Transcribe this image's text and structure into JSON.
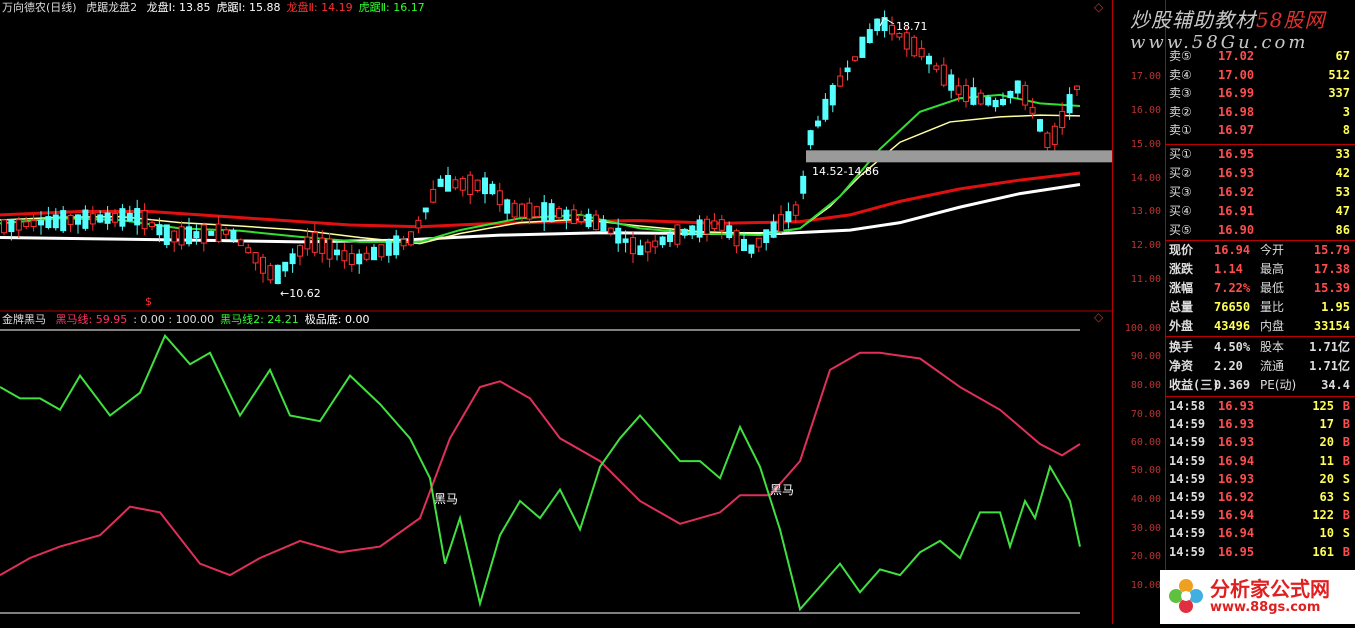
{
  "header_main": {
    "title": "万向德农(日线)",
    "indicator": "虎踞龙盘2",
    "items": [
      {
        "label": "龙盘Ⅰ: 13.85",
        "color": "#ffffff"
      },
      {
        "label": "虎踞Ⅰ: 15.88",
        "color": "#ffffff"
      },
      {
        "label": "龙盘Ⅱ: 14.19",
        "color": "#ff3030"
      },
      {
        "label": "虎踞Ⅱ: 16.17",
        "color": "#30ff30"
      }
    ]
  },
  "header_sub": {
    "title": "金牌黑马",
    "items": [
      {
        "label": "黑马线: 59.95",
        "color": "#ff3366"
      },
      {
        "label": ": 0.00 : 100.00",
        "color": "#dddddd"
      },
      {
        "label": "黑马线2: 24.21",
        "color": "#30ff30"
      },
      {
        "label": "极品底: 0.00",
        "color": "#ffffff"
      }
    ]
  },
  "annotations": {
    "high": "18.71",
    "low": "←10.62",
    "band": "14.52-14.86",
    "heima1": "黑马",
    "heima2": "黑马",
    "s_marker": "$"
  },
  "axis_main": [
    "17.00",
    "16.00",
    "15.00",
    "14.00",
    "13.00",
    "12.00",
    "11.00"
  ],
  "axis_sub": [
    "100.00",
    "90.00",
    "80.00",
    "70.00",
    "60.00",
    "50.00",
    "40.00",
    "30.00",
    "20.00",
    "10.00"
  ],
  "order_book": {
    "asks": [
      {
        "label": "卖⑤",
        "price": "17.02",
        "vol": "67"
      },
      {
        "label": "卖④",
        "price": "17.00",
        "vol": "512"
      },
      {
        "label": "卖③",
        "price": "16.99",
        "vol": "337"
      },
      {
        "label": "卖②",
        "price": "16.98",
        "vol": "3"
      },
      {
        "label": "卖①",
        "price": "16.97",
        "vol": "8"
      }
    ],
    "bids": [
      {
        "label": "买①",
        "price": "16.95",
        "vol": "33"
      },
      {
        "label": "买②",
        "price": "16.93",
        "vol": "42"
      },
      {
        "label": "买③",
        "price": "16.92",
        "vol": "53"
      },
      {
        "label": "买④",
        "price": "16.91",
        "vol": "47"
      },
      {
        "label": "买⑤",
        "price": "16.90",
        "vol": "86"
      }
    ]
  },
  "quote": [
    {
      "l1": "现价",
      "v1": "16.94",
      "l2": "今开",
      "v2": "15.79"
    },
    {
      "l1": "涨跌",
      "v1": "1.14",
      "l2": "最高",
      "v2": "17.38"
    },
    {
      "l1": "涨幅",
      "v1": "7.22%",
      "l2": "最低",
      "v2": "15.39"
    },
    {
      "l1": "总量",
      "v1": "76650",
      "l2": "量比",
      "v2": "1.95"
    },
    {
      "l1": "外盘",
      "v1": "43496",
      "l2": "内盘",
      "v2": "33154"
    },
    {
      "l1": "换手",
      "v1": "4.50%",
      "l2": "股本",
      "v2": "1.71亿"
    },
    {
      "l1": "净资",
      "v1": "2.20",
      "l2": "流通",
      "v2": "1.71亿"
    },
    {
      "l1": "收益(三)",
      "v1": "0.369",
      "l2": "PE(动)",
      "v2": "34.4"
    }
  ],
  "ticks": [
    {
      "time": "14:58",
      "price": "16.93",
      "vol": "125",
      "dir": "B"
    },
    {
      "time": "14:59",
      "price": "16.93",
      "vol": "17",
      "dir": "B"
    },
    {
      "time": "14:59",
      "price": "16.93",
      "vol": "20",
      "dir": "B"
    },
    {
      "time": "14:59",
      "price": "16.94",
      "vol": "11",
      "dir": "B"
    },
    {
      "time": "14:59",
      "price": "16.93",
      "vol": "20",
      "dir": "S"
    },
    {
      "time": "14:59",
      "price": "16.92",
      "vol": "63",
      "dir": "S"
    },
    {
      "time": "14:59",
      "price": "16.94",
      "vol": "122",
      "dir": "B"
    },
    {
      "time": "14:59",
      "price": "16.94",
      "vol": "10",
      "dir": "S"
    },
    {
      "time": "14:59",
      "price": "16.95",
      "vol": "161",
      "dir": "B"
    }
  ],
  "watermark": {
    "line1": "炒股辅助教材",
    "line1b": "58股网",
    "line2": "www.58Gu.com",
    "logo1": "分析家公式网",
    "logo2": "www.88gs.com"
  },
  "colors": {
    "up": "#ff3030",
    "down": "#54ffff",
    "ma_white": "#ffffff",
    "ma_red": "#e01010",
    "ma_green": "#30e030",
    "ma_yellow": "#ffffa0",
    "grid": "#b00000"
  }
}
